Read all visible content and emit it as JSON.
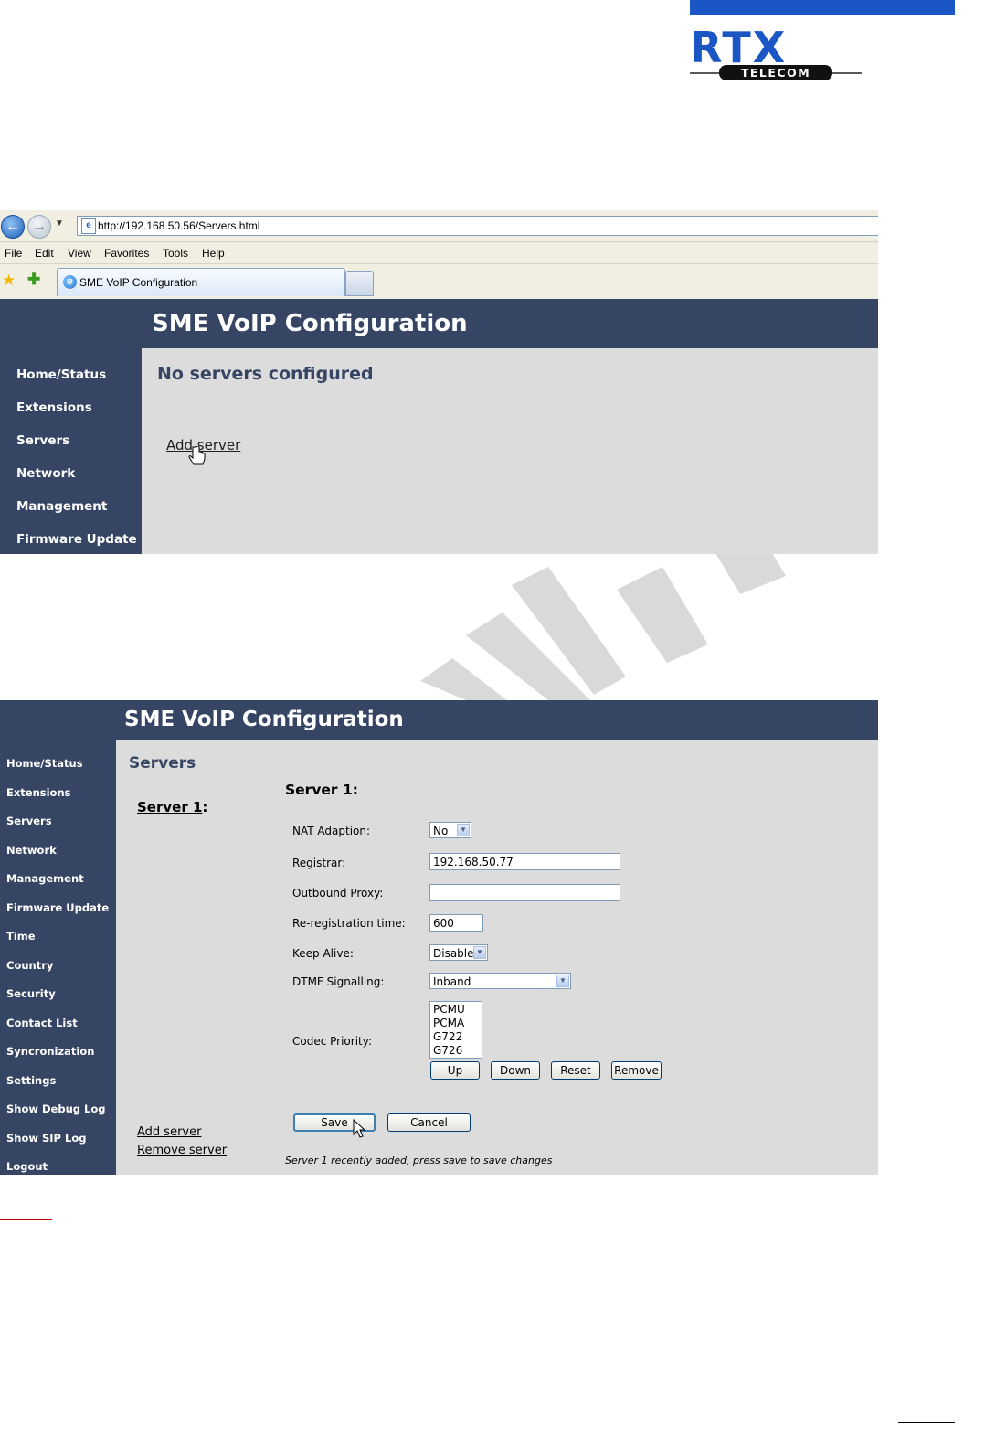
{
  "logo": {
    "text": "RTX",
    "subtext": "TELECOM",
    "bar_color": "#1a56c4"
  },
  "browser": {
    "url": "http://192.168.50.56/Servers.html",
    "menu": [
      "File",
      "Edit",
      "View",
      "Favorites",
      "Tools",
      "Help"
    ],
    "tab_title": "SME VoIP Configuration"
  },
  "app1": {
    "title": "SME VoIP Configuration",
    "sidebar": [
      "Home/Status",
      "Extensions",
      "Servers",
      "Network",
      "Management",
      "Firmware Update"
    ],
    "heading": "No servers configured",
    "add_server_link": "Add server"
  },
  "app2": {
    "title": "SME VoIP Configuration",
    "sidebar": [
      "Home/Status",
      "Extensions",
      "Servers",
      "Network",
      "Management",
      "Firmware Update",
      "Time",
      "Country",
      "Security",
      "Contact List",
      "Syncronization",
      "Settings",
      "Show Debug Log",
      "Show SIP Log",
      "Logout"
    ],
    "heading": "Servers",
    "server_link": {
      "name": "Server 1",
      "suffix": ":"
    },
    "form_title": "Server 1:",
    "fields": {
      "nat_label": "NAT Adaption:",
      "nat_value": "No",
      "registrar_label": "Registrar:",
      "registrar_value": "192.168.50.77",
      "proxy_label": "Outbound Proxy:",
      "proxy_value": "",
      "rereg_label": "Re-registration time:",
      "rereg_value": "600",
      "keepalive_label": "Keep Alive:",
      "keepalive_value": "Disable",
      "dtmf_label": "DTMF Signalling:",
      "dtmf_value": "Inband",
      "codec_label": "Codec Priority:",
      "codecs": [
        "PCMU",
        "PCMA",
        "G722",
        "G726"
      ]
    },
    "codec_buttons": {
      "up": "Up",
      "down": "Down",
      "reset": "Reset",
      "remove": "Remove"
    },
    "save_label": "Save",
    "cancel_label": "Cancel",
    "add_server_link": "Add server",
    "remove_server_link": "Remove server",
    "status_message": "Server 1 recently added, press save to save changes"
  },
  "colors": {
    "nav_bg": "#364563",
    "content_bg": "#dcdcdc",
    "heading": "#364563"
  }
}
